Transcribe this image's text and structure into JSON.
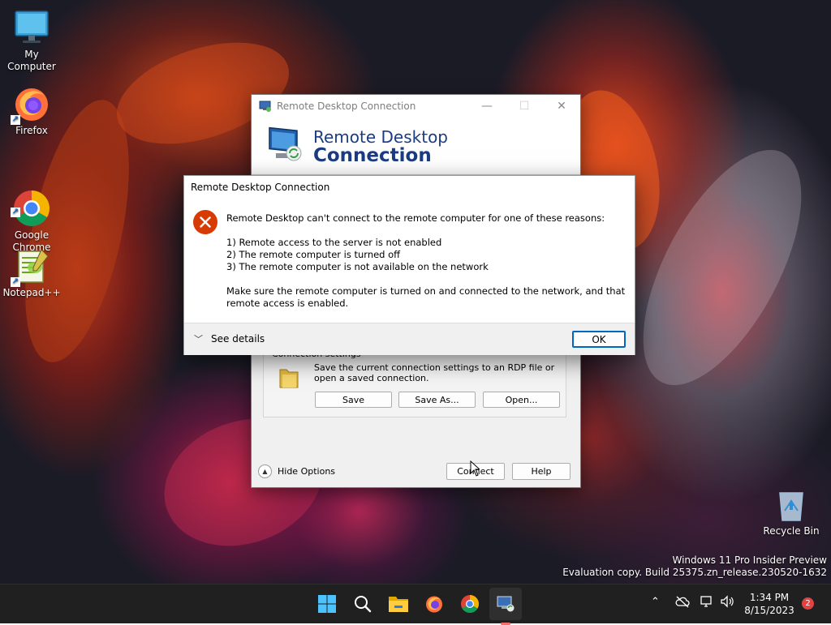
{
  "desktop": {
    "icons": [
      {
        "label": "My Computer",
        "icon": "monitor-icon"
      },
      {
        "label": "Firefox",
        "icon": "firefox-icon"
      },
      {
        "label": "Google\nChrome",
        "icon": "chrome-icon"
      },
      {
        "label": "Notepad++",
        "icon": "notepadpp-icon"
      },
      {
        "label": "Recycle Bin",
        "icon": "recycle-bin-icon"
      }
    ],
    "watermark": {
      "line1": "Windows 11 Pro Insider Preview",
      "line2": "Evaluation copy. Build 25375.zn_release.230520-1632"
    }
  },
  "rdc_window": {
    "title": "Remote Desktop Connection",
    "banner_line1": "Remote Desktop",
    "banner_line2": "Connection",
    "connection_settings": {
      "legend": "Connection settings",
      "description": "Save the current connection settings to an RDP file or open a saved connection.",
      "save_label": "Save",
      "save_as_label": "Save As...",
      "open_label": "Open..."
    },
    "hide_options_label": "Hide Options",
    "connect_label": "Connect",
    "help_label": "Help"
  },
  "error_dialog": {
    "title": "Remote Desktop Connection",
    "message_intro": "Remote Desktop can't connect to the remote computer for one of these reasons:",
    "reasons": [
      "1) Remote access to the server is not enabled",
      "2) The remote computer is turned off",
      "3) The remote computer is not available on the network"
    ],
    "message_outro": "Make sure the remote computer is turned on and connected to the network, and that remote access is enabled.",
    "see_details_label": "See details",
    "ok_label": "OK"
  },
  "taskbar": {
    "apps": [
      "start-icon",
      "search-icon",
      "file-explorer-icon",
      "firefox-icon",
      "chrome-icon",
      "remote-desktop-icon"
    ],
    "time": "1:34 PM",
    "date": "8/15/2023",
    "notification_count": "2"
  }
}
